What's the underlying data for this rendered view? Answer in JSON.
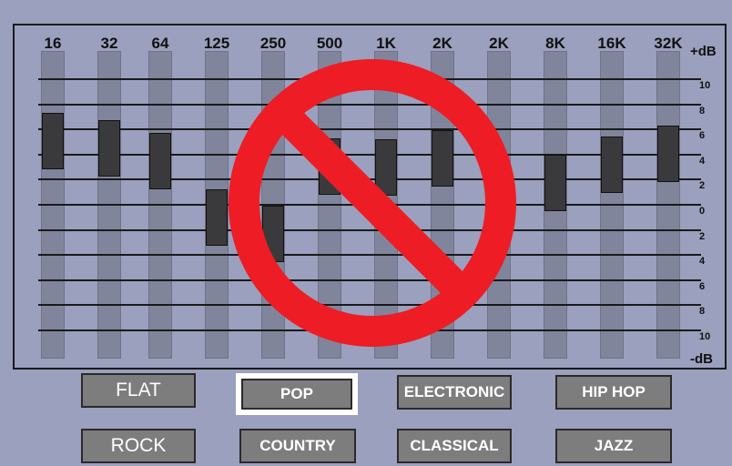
{
  "equalizer": {
    "bands": [
      {
        "freq": "16",
        "gain": 5.0
      },
      {
        "freq": "32",
        "gain": 4.4
      },
      {
        "freq": "64",
        "gain": 3.4
      },
      {
        "freq": "125",
        "gain": -1.1
      },
      {
        "freq": "250",
        "gain": -2.4
      },
      {
        "freq": "500",
        "gain": 3.0
      },
      {
        "freq": "1K",
        "gain": 2.9
      },
      {
        "freq": "2K",
        "gain": 3.6
      },
      {
        "freq": "2K",
        "gain": 0.2
      },
      {
        "freq": "8K",
        "gain": 1.7
      },
      {
        "freq": "16K",
        "gain": 3.1
      },
      {
        "freq": "32K",
        "gain": 4.0
      }
    ],
    "scale_labels": [
      "10",
      "8",
      "6",
      "4",
      "2",
      "0",
      "2",
      "4",
      "6",
      "8",
      "10"
    ],
    "top_unit": "+dB",
    "bottom_unit": "-dB"
  },
  "presets": {
    "flat": "FLAT",
    "pop": "POP",
    "electronic": "ELECTRONIC",
    "hiphop": "HIP HOP",
    "rock": "ROCK",
    "country": "COUNTRY",
    "classical": "CLASSICAL",
    "jazz": "JAZZ",
    "selected": "POP"
  },
  "colors": {
    "background": "#9aa0bd",
    "track": "#80859b",
    "knob": "#3a3a3c",
    "button": "#7d7d7d",
    "prohibition": "#ee1c24"
  },
  "overlay_icon": "prohibition-icon"
}
